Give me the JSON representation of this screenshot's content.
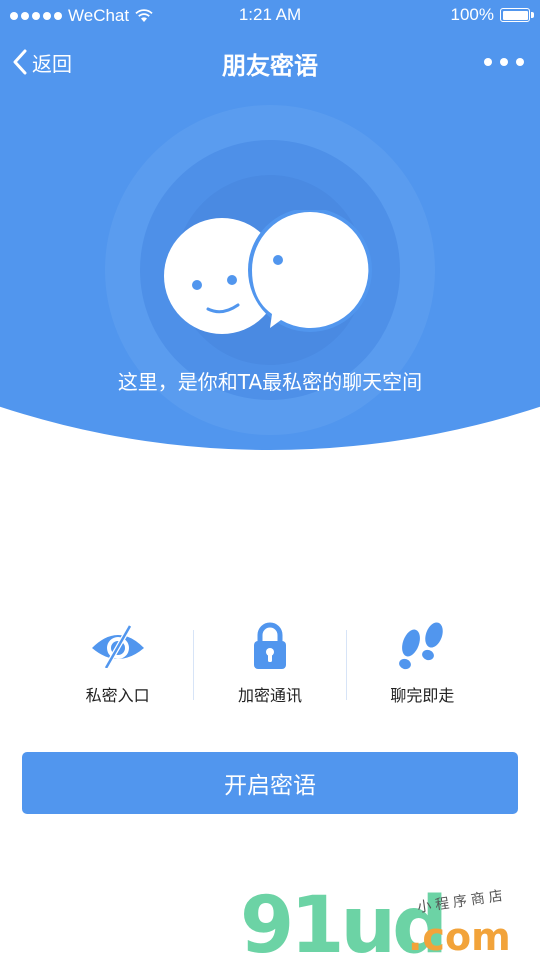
{
  "status_bar": {
    "carrier": "WeChat",
    "time": "1:21 AM",
    "battery": "100%"
  },
  "nav": {
    "back_label": "返回",
    "title": "朋友密语",
    "more_icon": "more-dots-icon"
  },
  "hero": {
    "tagline": "这里，是你和TA最私密的聊天空间",
    "icon": "chat-bubbles-icon"
  },
  "features": [
    {
      "icon": "eye-slash-icon",
      "label": "私密入口"
    },
    {
      "icon": "lock-icon",
      "label": "加密通讯"
    },
    {
      "icon": "footprints-icon",
      "label": "聊完即走"
    }
  ],
  "start_button": {
    "label": "开启密语"
  },
  "watermark": {
    "brand": "91ud",
    "domain": ".com",
    "tagline": "小程序商店"
  },
  "colors": {
    "primary": "#5196ee",
    "text_dark": "#222222",
    "watermark_green": "#6cd3a5",
    "watermark_orange": "#f2a33a"
  }
}
